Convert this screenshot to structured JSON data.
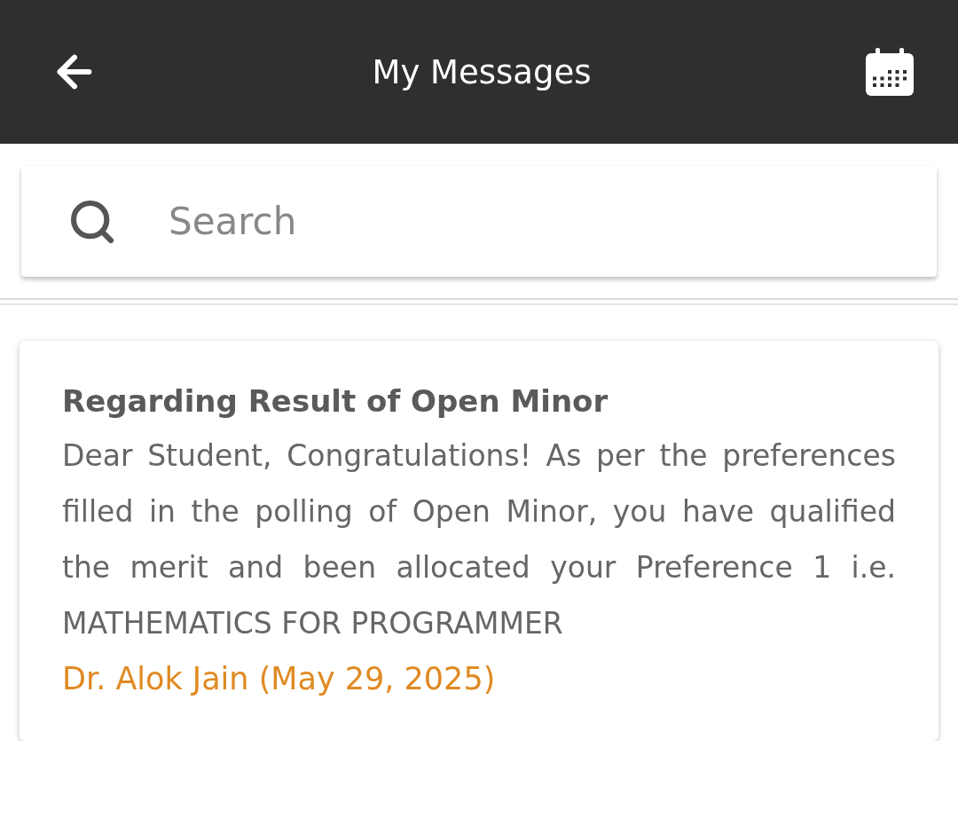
{
  "header": {
    "title": "My Messages"
  },
  "search": {
    "placeholder": "Search"
  },
  "messages": [
    {
      "subject": "Regarding Result of Open Minor",
      "body": "Dear Student, Congratulations! As per the preferences filled in the polling of Open Minor, you have qualified the merit and been allocated your Preference 1 i.e. MATHEMATICS FOR PROGRAMMER",
      "author": "Dr. Alok Jain (May 29, 2025)"
    }
  ]
}
